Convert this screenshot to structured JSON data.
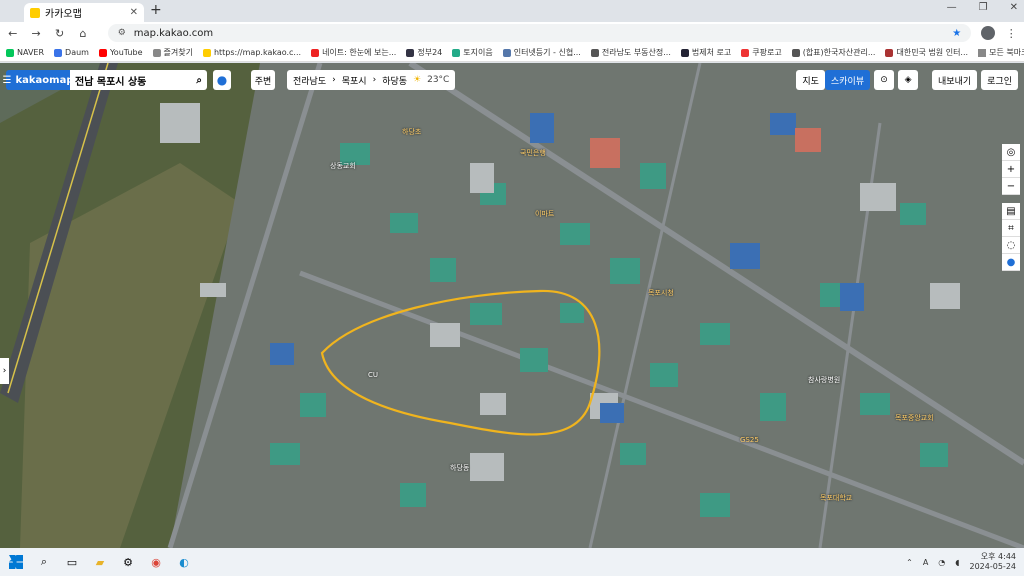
{
  "browser": {
    "tab_title": "카카오맵",
    "url": "map.kakao.com",
    "bookmarks": [
      "NAVER",
      "Daum",
      "YouTube",
      "즐겨찾기",
      "https://map.kakao.c...",
      "네이트: 한눈에 보는...",
      "정부24",
      "토지이음",
      "인터넷등기 - 신협...",
      "전라남도 부동산정...",
      "법제처 로고",
      "쿠팡로고",
      "(합표)한국자산관리...",
      "대한민국 법원 인터..."
    ],
    "all_bookmarks": "모든 북마크"
  },
  "map": {
    "logo": "kakaomap",
    "search_value": "전남 목포시 상동",
    "nearby_label": "주변",
    "breadcrumb": [
      "전라남도",
      "목포시",
      "하당동"
    ],
    "weather": "23°C",
    "view_map": "지도",
    "view_sky": "스카이뷰",
    "share": "내보내기",
    "login": "로그인",
    "labels": [
      "하당초",
      "상동교회",
      "국민은행",
      "이마트",
      "목포시청",
      "GS25",
      "CU",
      "목포중앙교회",
      "하당동",
      "목포대학교",
      "참사랑병원"
    ]
  },
  "taskbar": {
    "time": "오후 4:44",
    "date": "2024-05-24"
  }
}
